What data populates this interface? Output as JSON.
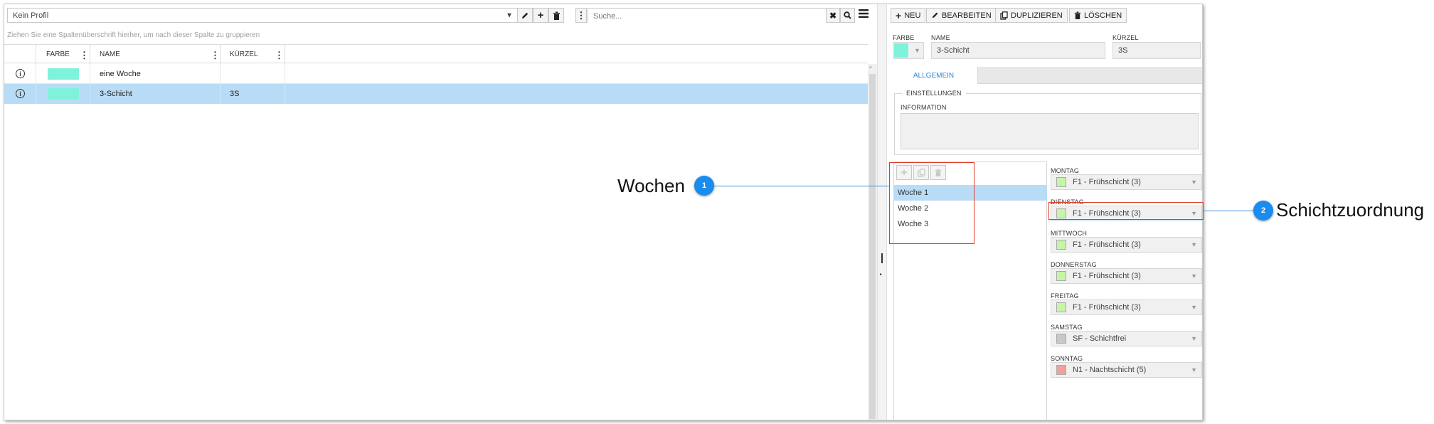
{
  "left": {
    "profile_select": "Kein Profil",
    "search_placeholder": "Suche...",
    "group_hint": "Ziehen Sie eine Spaltenüberschrift hierher, um nach dieser Spalte zu gruppieren",
    "columns": {
      "farbe": "FARBE",
      "name": "NAME",
      "kuerzel": "KÜRZEL"
    },
    "rows": [
      {
        "color": "#7ff2dc",
        "name": "eine Woche",
        "kuerzel": ""
      },
      {
        "color": "#7ff2dc",
        "name": "3-Schicht",
        "kuerzel": "3S"
      }
    ],
    "selected_row_color": "#b9dcf6"
  },
  "toolbar": {
    "new": "NEU",
    "edit": "BEARBEITEN",
    "duplicate": "DUPLIZIEREN",
    "delete": "LÖSCHEN"
  },
  "form": {
    "farbe_label": "FARBE",
    "farbe_value": "#7ff2dc",
    "name_label": "NAME",
    "name_value": "3-Schicht",
    "kuerzel_label": "KÜRZEL",
    "kuerzel_value": "3S",
    "tab_general": "ALLGEMEIN",
    "fieldset_settings": "EINSTELLUNGEN",
    "info_label": "INFORMATION",
    "info_value": ""
  },
  "weeks": [
    {
      "label": "Woche 1",
      "selected": true
    },
    {
      "label": "Woche 2",
      "selected": false
    },
    {
      "label": "Woche 3",
      "selected": false
    }
  ],
  "days": [
    {
      "label": "MONTAG",
      "value": "F1 - Frühschicht (3)",
      "color": "#c6f5a6"
    },
    {
      "label": "DIENSTAG",
      "value": "F1 - Frühschicht (3)",
      "color": "#c6f5a6"
    },
    {
      "label": "MITTWOCH",
      "value": "F1 - Frühschicht (3)",
      "color": "#c6f5a6"
    },
    {
      "label": "DONNERSTAG",
      "value": "F1 - Frühschicht (3)",
      "color": "#c6f5a6"
    },
    {
      "label": "FREITAG",
      "value": "F1 - Frühschicht (3)",
      "color": "#c6f5a6"
    },
    {
      "label": "SAMSTAG",
      "value": "SF - Schichtfrei",
      "color": "#c8c8c8"
    },
    {
      "label": "SONNTAG",
      "value": "N1 - Nachtschicht (5)",
      "color": "#f4a09a"
    }
  ],
  "callouts": [
    {
      "number": "1",
      "label": "Wochen"
    },
    {
      "number": "2",
      "label": "Schichtzuordnung"
    }
  ],
  "colors": {
    "accent": "#1a8cf0",
    "highlight": "#e23b2a",
    "tab_text": "#2f86d8"
  }
}
